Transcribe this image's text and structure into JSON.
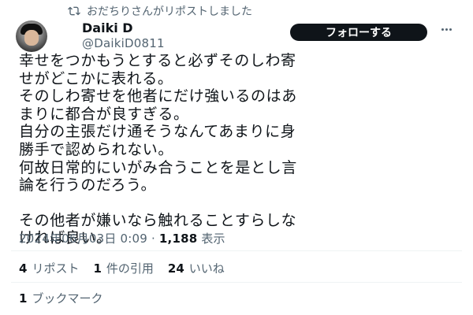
{
  "repost_banner": {
    "text": "おだちりさんがリポストしました",
    "icon": "repost-icon"
  },
  "author": {
    "display_name": "Daiki D",
    "handle": "@DaikiD0811",
    "avatar": "avatar"
  },
  "actions": {
    "follow_label": "フォローする",
    "more_icon": "more-icon"
  },
  "tweet": {
    "lines": [
      "幸せをつかもうとすると必ずそのしわ寄",
      "せがどこかに表れる。",
      "そのしわ寄せを他者にだけ強いるのはあ",
      "まりに都合が良すぎる。",
      "自分の主張だけ通そうなんてあまりに身",
      "勝手で認められない。",
      "何故日常的にいがみ合うことを是とし言",
      "論を行うのだろう。",
      "",
      "その他者が嫌いなら触れることすらしな",
      "ければ良い。"
    ]
  },
  "meta": {
    "timestamp": "2024年06月03日 0:09",
    "separator": "·",
    "views_count": "1,188",
    "views_label": "表示"
  },
  "stats": {
    "reposts_count": "4",
    "reposts_label": "リポスト",
    "quotes_count": "1",
    "quotes_label": "件の引用",
    "likes_count": "24",
    "likes_label": "いいね",
    "bookmarks_count": "1",
    "bookmarks_label": "ブックマーク"
  },
  "colors": {
    "text_primary": "#0f1419",
    "text_secondary": "#536471",
    "button_bg": "#0f1419",
    "divider": "#eff3f4"
  }
}
